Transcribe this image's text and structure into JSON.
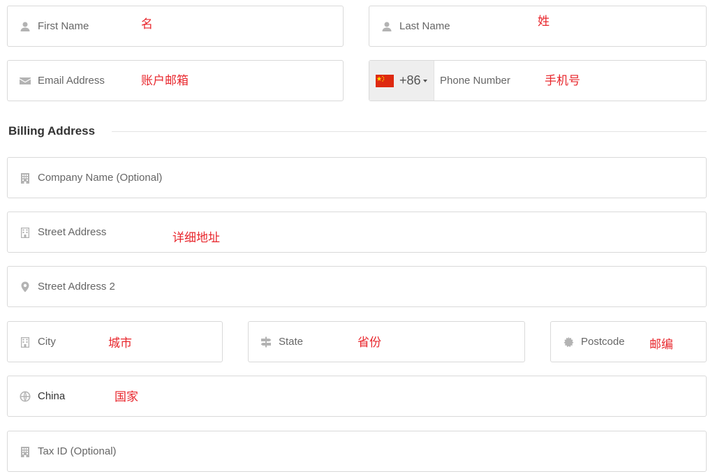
{
  "contact": {
    "first_name": {
      "placeholder": "First Name",
      "note": "名"
    },
    "last_name": {
      "placeholder": "Last Name",
      "note": "姓"
    },
    "email": {
      "placeholder": "Email Address",
      "note": "账户邮箱"
    },
    "phone": {
      "dial_code": "+86",
      "placeholder": "Phone Number",
      "note": "手机号",
      "flag_colors": {
        "red": "#de2910",
        "yellow": "#ffde00"
      }
    }
  },
  "billing": {
    "title": "Billing Address",
    "company": {
      "placeholder": "Company Name (Optional)"
    },
    "street": {
      "placeholder": "Street Address",
      "note": "详细地址"
    },
    "street2": {
      "placeholder": "Street Address 2"
    },
    "city": {
      "placeholder": "City",
      "note": "城市"
    },
    "state": {
      "placeholder": "State",
      "note": "省份"
    },
    "postcode": {
      "placeholder": "Postcode",
      "note": "邮编"
    },
    "country": {
      "value": "China",
      "note": "国家"
    },
    "tax_id": {
      "placeholder": "Tax ID (Optional)"
    }
  },
  "colors": {
    "annotation": "#e8272d",
    "border": "#d9d9d9",
    "icon": "#b3b3b3"
  },
  "icons": [
    "user-icon",
    "envelope-icon",
    "building-icon",
    "map-pin-icon",
    "signpost-icon",
    "badge-icon",
    "globe-icon"
  ]
}
